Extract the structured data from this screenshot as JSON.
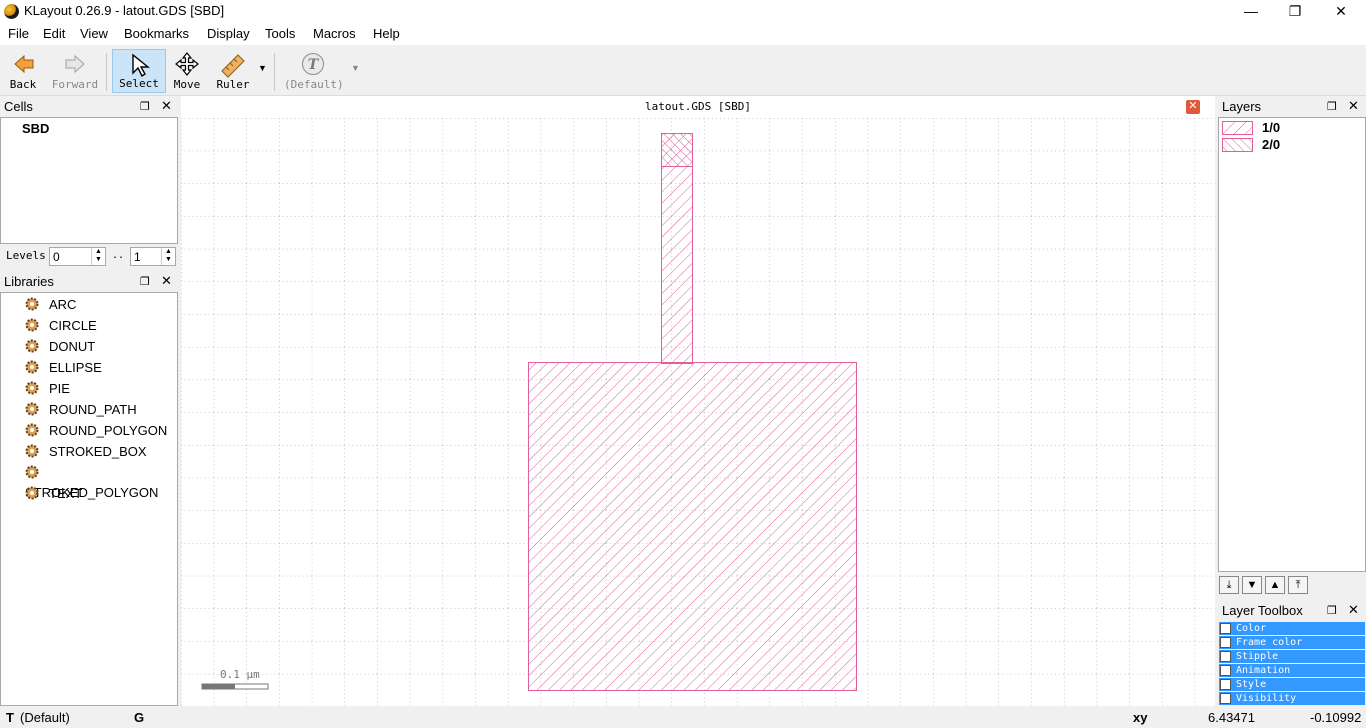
{
  "window": {
    "title": "KLayout 0.26.9 - latout.GDS [SBD]",
    "minimize": "—",
    "maximize": "❐",
    "close": "✕"
  },
  "menu": [
    "File",
    "Edit",
    "View",
    "Bookmarks",
    "Display",
    "Tools",
    "Macros",
    "Help"
  ],
  "toolbar": {
    "back": "Back",
    "forward": "Forward",
    "select": "Select",
    "move": "Move",
    "ruler": "Ruler",
    "default": "(Default)"
  },
  "cells": {
    "title": "Cells",
    "items": [
      "SBD"
    ],
    "levels_label": "Levels",
    "level_from": "0",
    "level_sep": "..",
    "level_to": "1"
  },
  "libraries": {
    "title": "Libraries",
    "items": [
      "ARC",
      "CIRCLE",
      "DONUT",
      "ELLIPSE",
      "PIE",
      "ROUND_PATH",
      "ROUND_POLYGON",
      "STROKED_BOX",
      "STROKED_POLYGON",
      "TEXT"
    ]
  },
  "canvas": {
    "title": "latout.GDS [SBD]",
    "scale_label": "0.1 µm",
    "layer_color": "#e0609a"
  },
  "layers": {
    "title": "Layers",
    "items": [
      "1/0",
      "2/0"
    ]
  },
  "layer_toolbox": {
    "title": "Layer Toolbox",
    "items": [
      "Color",
      "Frame color",
      "Stipple",
      "Animation",
      "Style",
      "Visibility"
    ]
  },
  "status": {
    "mode_icon": "T",
    "mode": "(Default)",
    "grid": "G",
    "coord_label": "xy",
    "x": "6.43471",
    "y": "-0.10992"
  }
}
